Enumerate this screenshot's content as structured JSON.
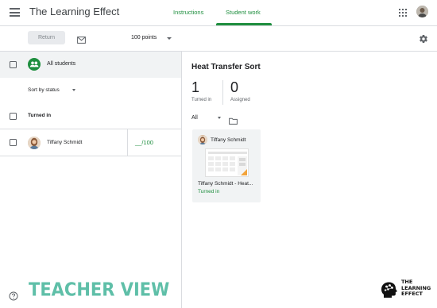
{
  "header": {
    "app_title": "The Learning Effect",
    "tabs": [
      {
        "label": "Instructions",
        "active": false
      },
      {
        "label": "Student work",
        "active": true
      }
    ],
    "icons": [
      "menu-icon",
      "apps-icon",
      "account-avatar"
    ]
  },
  "toolbar": {
    "return_label": "Return",
    "points_value": "100 points",
    "icons": [
      "mail-icon",
      "settings-icon"
    ]
  },
  "students_panel": {
    "all_students_label": "All students",
    "sort_label": "Sort by status",
    "turned_in_header": "Turned in",
    "rows": [
      {
        "name": "Tiffany Schmidt",
        "grade": "__/100"
      }
    ]
  },
  "assignment": {
    "title": "Heat Transfer Sort",
    "stats": [
      {
        "count": "1",
        "label": "Turned in"
      },
      {
        "count": "0",
        "label": "Assigned"
      }
    ],
    "filter_value": "All",
    "card": {
      "student_name": "Tiffany Schmidt",
      "file_name": "Tiffany Schmidt - Heat...",
      "status": "Turned in"
    }
  },
  "overlay": {
    "caption": "TEACHER VIEW",
    "logo_text": [
      "THE",
      "LEARNING",
      "EFFECT"
    ]
  },
  "colors": {
    "accent_green": "#1e8e3e",
    "caption_teal": "#5fbfa8",
    "divider": "#dadce0",
    "row_highlight": "#f1f3f4"
  }
}
